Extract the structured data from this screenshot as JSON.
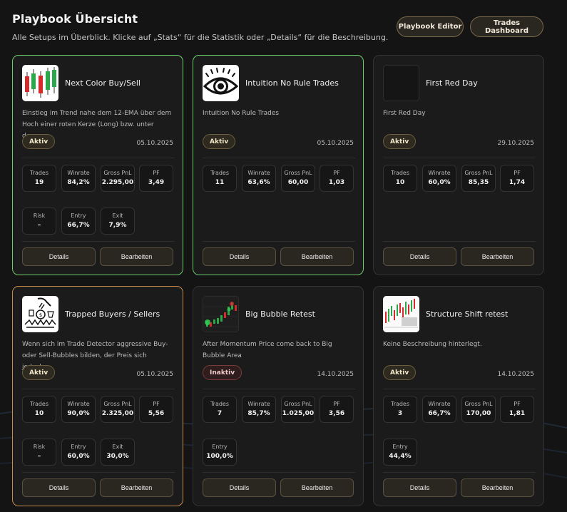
{
  "header": {
    "title": "Playbook Übersicht",
    "subtitle": "Alle Setups im Überblick. Klicke auf „Stats“ für die Statistik oder „Details“ für die Beschreibung."
  },
  "toolbar": {
    "playbook_editor": "Playbook Editor",
    "trades_dashboard": "Trades Dashboard"
  },
  "colors": {
    "active_border": "#6ccf6c",
    "highlight_border": "#c98a4a",
    "accent": "#7a6a4a"
  },
  "labels": {
    "trades": "Trades",
    "winrate": "Winrate",
    "gross_pnl": "Gross PnL",
    "pf": "PF",
    "risk": "Risk",
    "entry": "Entry",
    "exit": "Exit",
    "details": "Details",
    "edit": "Bearbeiten"
  },
  "cards": [
    {
      "title": "Next Color Buy/Sell",
      "description": "Einstieg im Trend nahe dem 12-EMA über dem Hoch einer roten Kerze (Long) bzw. unter dem...",
      "status": "Aktiv",
      "date": "05.10.2025",
      "icon": "candlestick-icon",
      "stats": {
        "trades": "19",
        "winrate": "84,2%",
        "gross_pnl": "2.295,00",
        "pf": "3,49"
      },
      "extra": {
        "risk": "–",
        "entry": "66,7%",
        "exit": "7,9%"
      }
    },
    {
      "title": "Intuition No Rule Trades",
      "description": "Intuition No Rule Trades",
      "status": "Aktiv",
      "date": "05.10.2025",
      "icon": "eye-icon",
      "stats": {
        "trades": "11",
        "winrate": "63,6%",
        "gross_pnl": "60,00",
        "pf": "1,03"
      },
      "extra": {}
    },
    {
      "title": "First Red Day",
      "description": "First Red Day",
      "status": "Aktiv",
      "date": "29.10.2025",
      "icon": "empty-thumbnail",
      "stats": {
        "trades": "10",
        "winrate": "60,0%",
        "gross_pnl": "85,35",
        "pf": "1,74"
      },
      "extra": {}
    },
    {
      "title": "Trapped Buyers / Sellers",
      "description": "Wenn sich im Trade Detector aggressive Buy- oder Sell-Bubbles bilden, der Preis sich jedoch...",
      "status": "Aktiv",
      "date": "05.10.2025",
      "icon": "trap-icon",
      "stats": {
        "trades": "10",
        "winrate": "90,0%",
        "gross_pnl": "2.325,00",
        "pf": "5,56"
      },
      "extra": {
        "risk": "–",
        "entry": "60,0%",
        "exit": "30,0%"
      }
    },
    {
      "title": "Big Bubble Retest",
      "description": "After Momentum Price come back to Big Bubble Area",
      "status": "Inaktiv",
      "date": "14.10.2025",
      "icon": "bubble-chart-icon",
      "stats": {
        "trades": "7",
        "winrate": "85,7%",
        "gross_pnl": "1.025,00",
        "pf": "3,56"
      },
      "extra": {
        "entry": "100,0%"
      }
    },
    {
      "title": "Structure Shift retest",
      "description": "Keine Beschreibung hinterlegt.",
      "status": "Aktiv",
      "date": "14.10.2025",
      "icon": "structure-chart-icon",
      "stats": {
        "trades": "3",
        "winrate": "66,7%",
        "gross_pnl": "170,00",
        "pf": "1,81"
      },
      "extra": {
        "entry": "44,4%"
      }
    }
  ]
}
